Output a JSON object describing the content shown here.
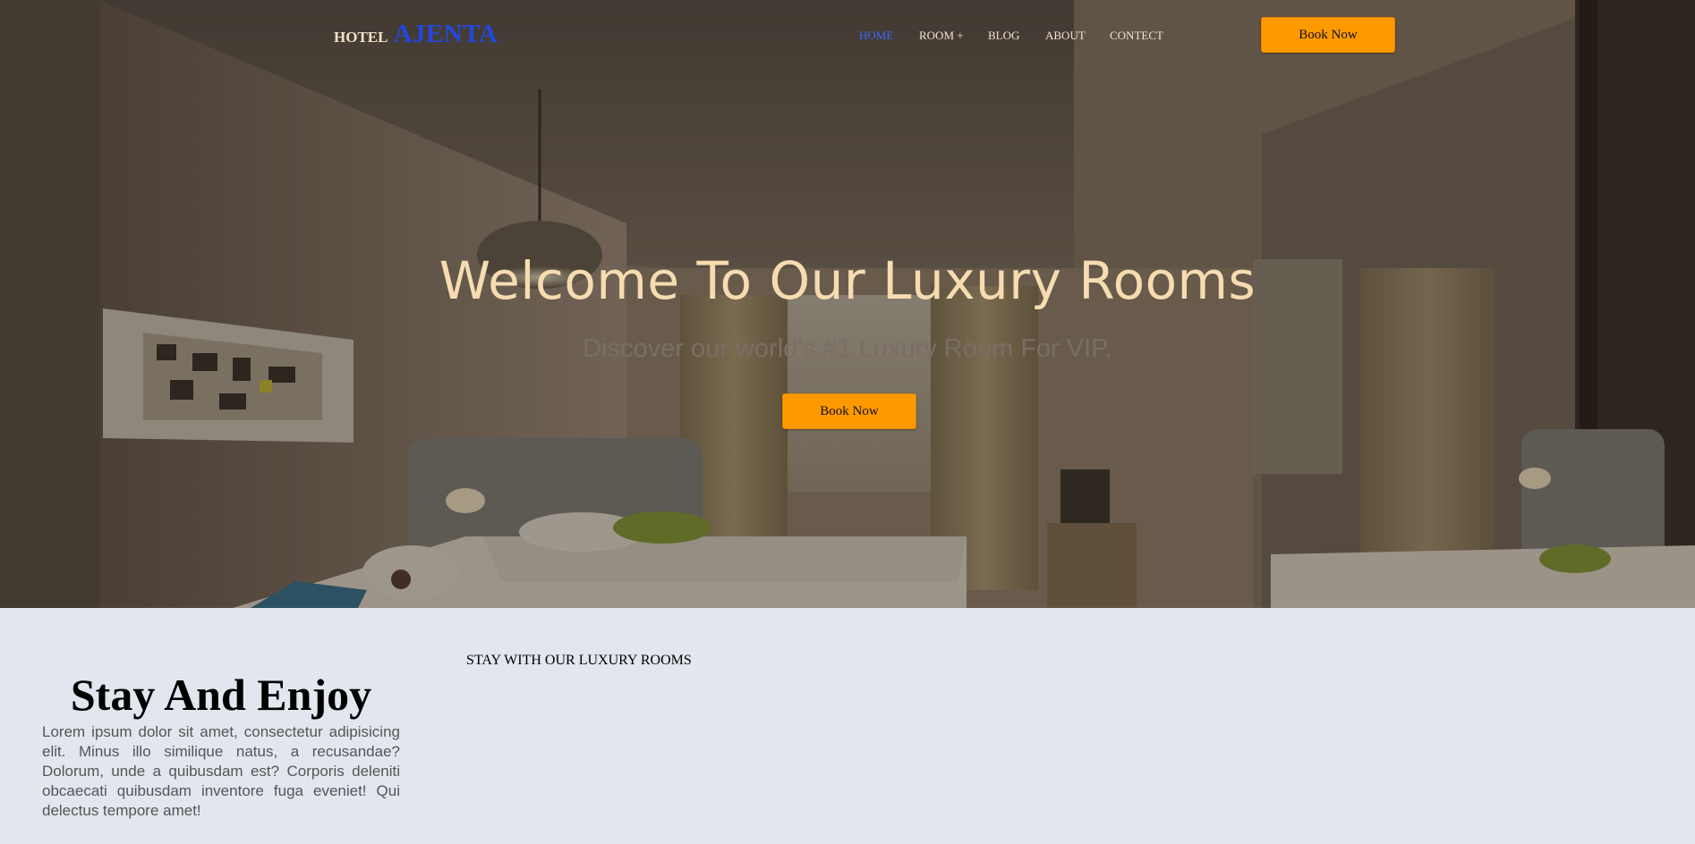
{
  "header": {
    "logo_small": "HOTEL",
    "logo_big": "AJENTA",
    "nav": [
      {
        "label": "HOME",
        "active": true
      },
      {
        "label": "ROOM +",
        "active": false
      },
      {
        "label": "BLOG",
        "active": false
      },
      {
        "label": "ABOUT",
        "active": false
      },
      {
        "label": "CONTECT",
        "active": false
      }
    ],
    "book_label": "Book Now"
  },
  "hero": {
    "title": "Welcome To Our Luxury Rooms",
    "subtitle": "Discover our world's #1 Luxury Room For VIP.",
    "book_label": "Book Now"
  },
  "about": {
    "title": "Stay And Enjoy",
    "text": "Lorem ipsum dolor sit amet, consectetur adipisicing elit. Minus illo similique natus, a recusandae? Dolorum, unde a quibusdam est? Corporis deleniti obcaecati quibusdam inventore fuga eveniet! Qui delectus tempore amet!",
    "rooms_label": "STAY WITH OUR LUXURY ROOMS"
  },
  "colors": {
    "accent_orange": "#ff9900",
    "logo_blue": "#2247e0",
    "nav_active": "#3b68ff",
    "hero_title": "#f6dcb0",
    "section_bg": "#e2e6ee"
  }
}
